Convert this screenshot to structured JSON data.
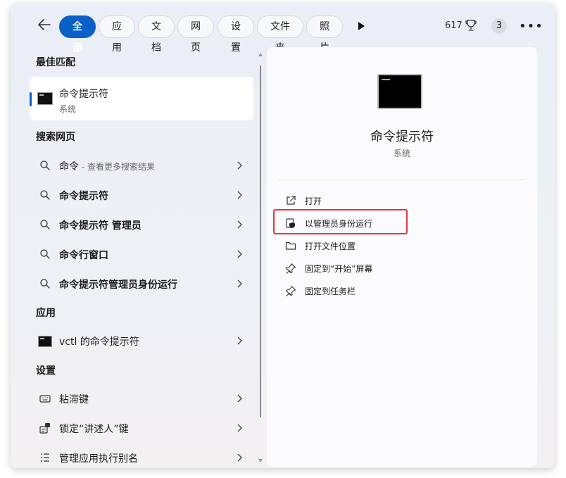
{
  "filters": {
    "tabs": [
      "全部",
      "应用",
      "文档",
      "网页",
      "设置",
      "文件夹",
      "照片"
    ],
    "active_tab": "全部",
    "points": "617",
    "avatar_count": "3",
    "more_label": "•••"
  },
  "best_match": {
    "section": "最佳匹配",
    "name": "命令提示符",
    "sub": "系统"
  },
  "web": {
    "section": "搜索网页",
    "items": [
      {
        "label": "命令",
        "hint": " - 查看更多搜索结果"
      },
      {
        "label": "命令提示符"
      },
      {
        "label": "命令提示符 管理员"
      },
      {
        "label": "命令行窗口"
      },
      {
        "label": "命令提示符管理员身份运行"
      }
    ]
  },
  "apps": {
    "section": "应用",
    "items": [
      {
        "label": "vctl 的命令提示符"
      }
    ]
  },
  "settings": {
    "section": "设置",
    "items": [
      {
        "label": "粘滞键",
        "icon": "keyboard-icon"
      },
      {
        "label": "锁定“讲述人”键",
        "icon": "narrator-lock-icon"
      },
      {
        "label": "管理应用执行别名",
        "icon": "list-icon"
      }
    ]
  },
  "detail": {
    "title": "命令提示符",
    "sub": "系统",
    "actions": [
      {
        "label": "打开",
        "icon": "open-external-icon"
      },
      {
        "label": "以管理员身份运行",
        "icon": "admin-shield-icon"
      },
      {
        "label": "打开文件位置",
        "icon": "folder-icon"
      },
      {
        "label": "固定到“开始”屏幕",
        "icon": "pin-icon"
      },
      {
        "label": "固定到任务栏",
        "icon": "pin-icon"
      }
    ]
  },
  "colors": {
    "accent": "#0a5fc8",
    "highlight": "#e0393e"
  }
}
